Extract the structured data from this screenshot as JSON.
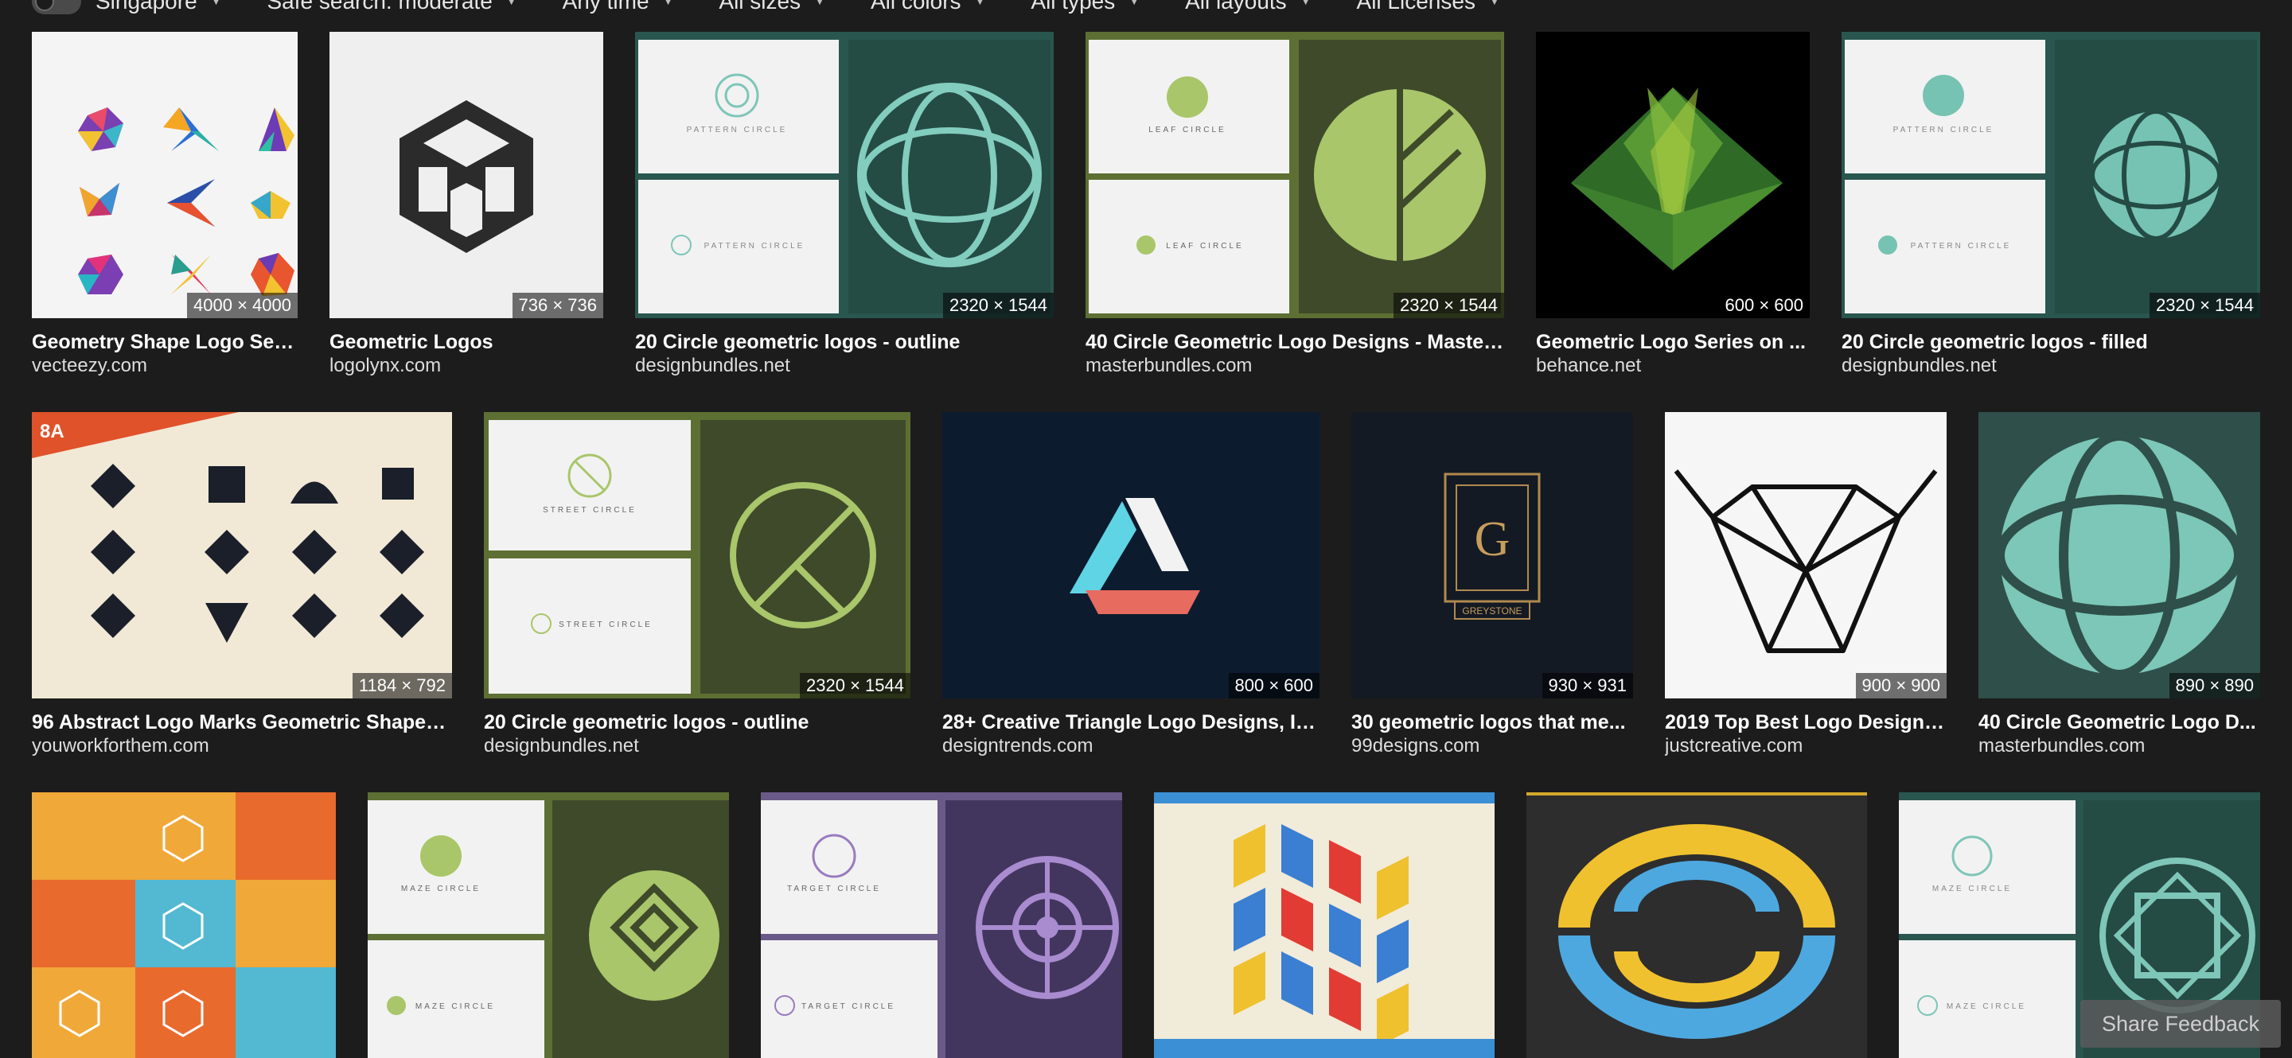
{
  "filters": {
    "region": "Singapore",
    "safe_search": "Safe search: moderate",
    "time": "Any time",
    "sizes": "All sizes",
    "colors": "All colors",
    "types": "All types",
    "layouts": "All layouts",
    "licenses": "All Licenses"
  },
  "results": [
    {
      "title": "Geometry Shape Logo Set ...",
      "source": "vecteezy.com",
      "dims": "4000 × 4000"
    },
    {
      "title": "Geometric Logos",
      "source": "logolynx.com",
      "dims": "736 × 736"
    },
    {
      "title": "20 Circle geometric logos - outline",
      "source": "designbundles.net",
      "dims": "2320 × 1544",
      "labels": [
        "PATTERN CIRCLE",
        "PATTERN CIRCLE"
      ]
    },
    {
      "title": "40 Circle Geometric Logo Designs - Master...",
      "source": "masterbundles.com",
      "dims": "2320 × 1544",
      "labels": [
        "LEAF CIRCLE",
        "LEAF CIRCLE"
      ]
    },
    {
      "title": "Geometric Logo Series on ...",
      "source": "behance.net",
      "dims": "600 × 600"
    },
    {
      "title": "20 Circle geometric logos - filled",
      "source": "designbundles.net",
      "dims": "2320 × 1544",
      "labels": [
        "PATTERN CIRCLE",
        "PATTERN CIRCLE"
      ]
    },
    {
      "title": "96 Abstract Logo Marks Geometric Shapes...",
      "source": "youworkforthem.com",
      "dims": "1184 × 792",
      "badge": "8A"
    },
    {
      "title": "20 Circle geometric logos - outline",
      "source": "designbundles.net",
      "dims": "2320 × 1544",
      "labels": [
        "STREET CIRCLE",
        "STREET CIRCLE"
      ]
    },
    {
      "title": "28+ Creative Triangle Logo Designs, Id...",
      "source": "designtrends.com",
      "dims": "800 × 600"
    },
    {
      "title": "30 geometric logos that me...",
      "source": "99designs.com",
      "dims": "930 × 931",
      "emblem": "GREYSTONE"
    },
    {
      "title": "2019 Top Best Logo Designs...",
      "source": "justcreative.com",
      "dims": "900 × 900"
    },
    {
      "title": "40 Circle Geometric Logo D...",
      "source": "masterbundles.com",
      "dims": "890 × 890"
    },
    {
      "labels": [
        "MAZE CIRCLE",
        "MAZE CIRCLE"
      ]
    },
    {
      "labels": [
        "TARGET CIRCLE",
        "TARGET CIRCLE"
      ]
    },
    {
      "labels": [
        "MAZE CIRCLE",
        "MAZE CIRCLE"
      ]
    }
  ],
  "feedback": "Share Feedback"
}
